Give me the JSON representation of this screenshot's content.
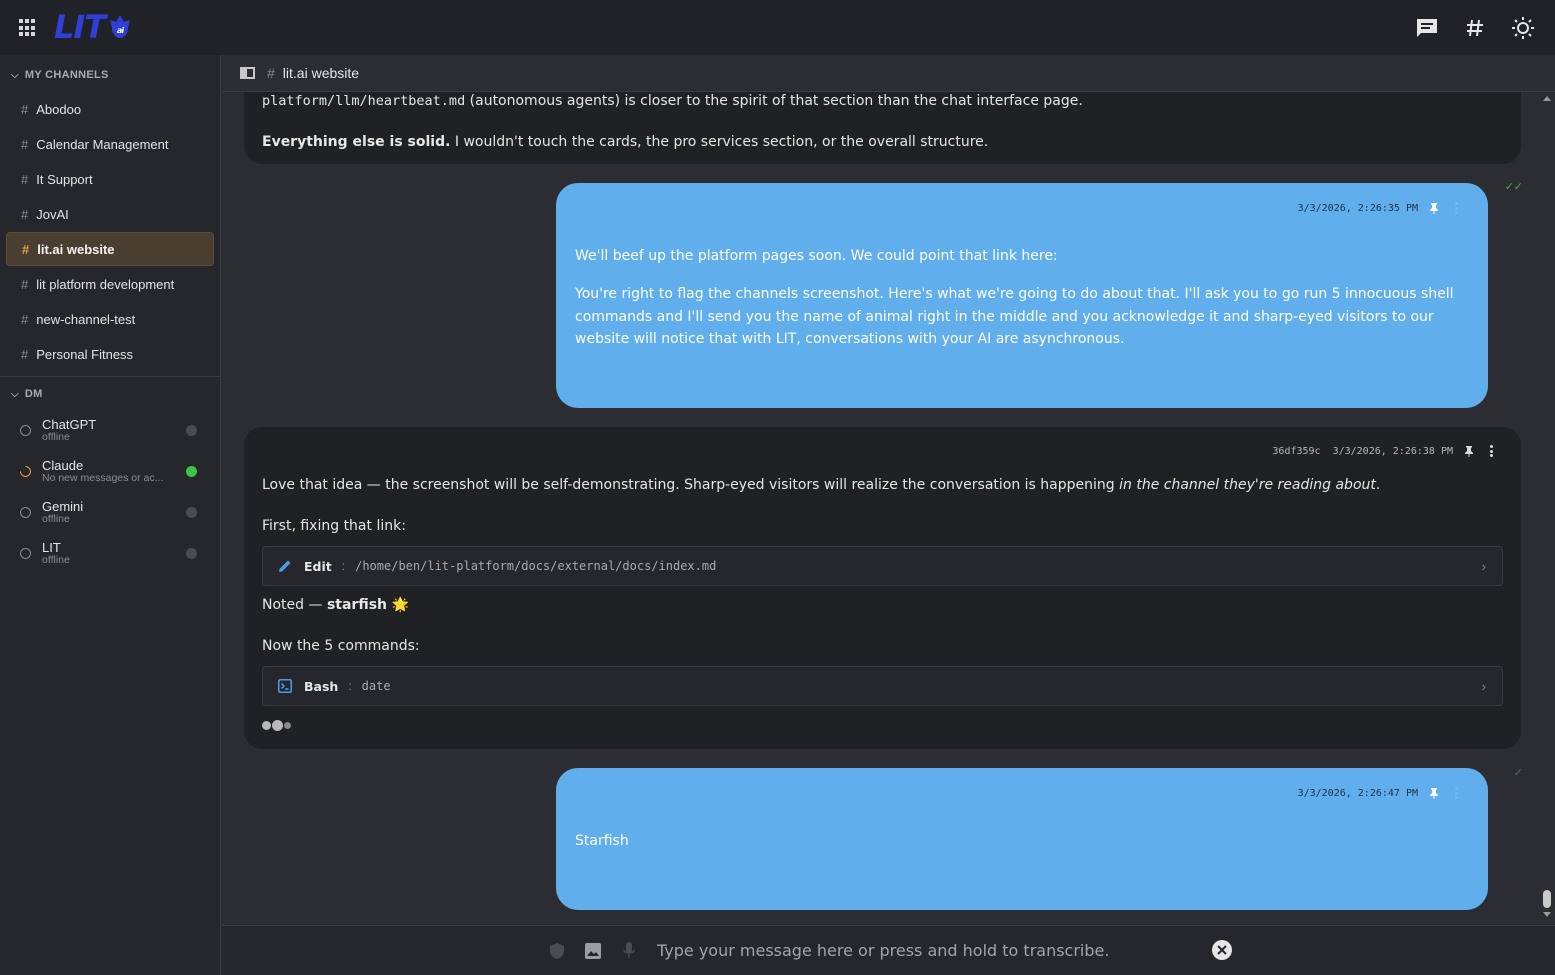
{
  "app": {
    "logo_text": "LIT",
    "logo_badge": "ai"
  },
  "sidebar": {
    "channels_heading": "MY CHANNELS",
    "channels": [
      {
        "label": "Abodoo"
      },
      {
        "label": "Calendar Management"
      },
      {
        "label": "It Support"
      },
      {
        "label": "JovAI"
      },
      {
        "label": "lit.ai website",
        "active": true
      },
      {
        "label": "lit platform development"
      },
      {
        "label": "new-channel-test"
      },
      {
        "label": "Personal Fitness"
      }
    ],
    "dm_heading": "DM",
    "dms": [
      {
        "name": "ChatGPT",
        "status": "offline",
        "online": false
      },
      {
        "name": "Claude",
        "status": "No new messages or ac...",
        "online": true
      },
      {
        "name": "Gemini",
        "status": "offline",
        "online": false
      },
      {
        "name": "LIT",
        "status": "offline",
        "online": false
      }
    ]
  },
  "header": {
    "channel_title": "lit.ai website"
  },
  "messages": {
    "m1": {
      "line1_code": "platform/llm/heartbeat.md",
      "line1_rest": " (autonomous agents) is closer to the spirit of that section than the chat interface page.",
      "line2_bold": "Everything else is solid.",
      "line2_rest": " I wouldn't touch the cards, the pro services section, or the overall structure."
    },
    "m2": {
      "timestamp": "3/3/2026, 2:26:35 PM",
      "p1": "We'll beef up the platform pages soon. We could point that link here:",
      "p2": "You're right to flag the channels screenshot. Here's what we're going to do about that. I'll ask you to go run 5 innocuous shell commands and I'll send you the name of animal right in the middle and you acknowledge it and sharp-eyed visitors to our website will notice that with LIT, conversations with your AI are asynchronous."
    },
    "m3": {
      "hash": "36df359c",
      "timestamp": "3/3/2026, 2:26:38 PM",
      "p1_start": "Love that idea — the screenshot will be self-demonstrating. Sharp-eyed visitors will realize the conversation is happening ",
      "p1_italic": "in the channel they're reading about",
      "p1_end": ".",
      "p2": "First, fixing that link:",
      "tool1": {
        "name": "Edit",
        "sep": ":",
        "arg": "/home/ben/lit-platform/docs/external/docs/index.md"
      },
      "p3_start": "Noted — ",
      "p3_bold": "starfish",
      "p3_emoji": "🌟",
      "p4": "Now the 5 commands:",
      "tool2": {
        "name": "Bash",
        "sep": ":",
        "arg": "date"
      }
    },
    "m4": {
      "timestamp": "3/3/2026, 2:26:47 PM",
      "p1": "Starfish"
    }
  },
  "composer": {
    "placeholder": "Type your message here or press and hold to transcribe."
  },
  "colors": {
    "user_bubble": "#60aeec",
    "ai_bubble": "#1f2125",
    "logo": "#2f3fd8",
    "active_channel": "#4a3e31",
    "online": "#3ec24a"
  }
}
